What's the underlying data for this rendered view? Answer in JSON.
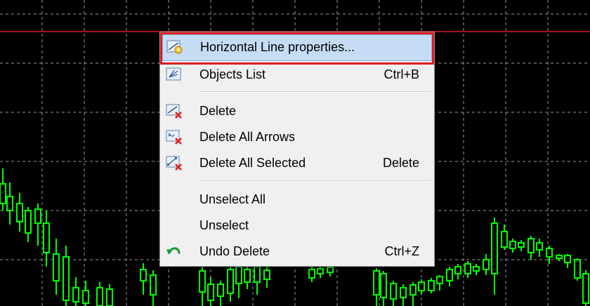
{
  "colors": {
    "chart_background": "#000000",
    "grid": "#9a9a9a",
    "candle": "#00ff00",
    "horizontal_line": "#dd1a24",
    "menu_background": "#f0f0f0",
    "menu_highlight": "#c5dcf4",
    "highlight_frame": "#dd1a24"
  },
  "chart": {
    "horizontal_line_selected": true
  },
  "context_menu": {
    "items": [
      {
        "label": "Horizontal Line properties...",
        "shortcut": "",
        "icon": "line-properties-icon",
        "highlighted": true
      },
      {
        "label": "Objects List",
        "shortcut": "Ctrl+B",
        "icon": "objects-list-icon"
      },
      {
        "label": "Delete",
        "shortcut": "",
        "icon": "delete-object-icon"
      },
      {
        "label": "Delete All Arrows",
        "shortcut": "",
        "icon": "delete-arrows-icon"
      },
      {
        "label": "Delete All Selected",
        "shortcut": "Delete",
        "icon": "delete-selected-icon"
      },
      {
        "label": "Unselect All",
        "shortcut": ""
      },
      {
        "label": "Unselect",
        "shortcut": ""
      },
      {
        "label": "Undo Delete",
        "shortcut": "Ctrl+Z",
        "icon": "undo-icon"
      }
    ]
  }
}
